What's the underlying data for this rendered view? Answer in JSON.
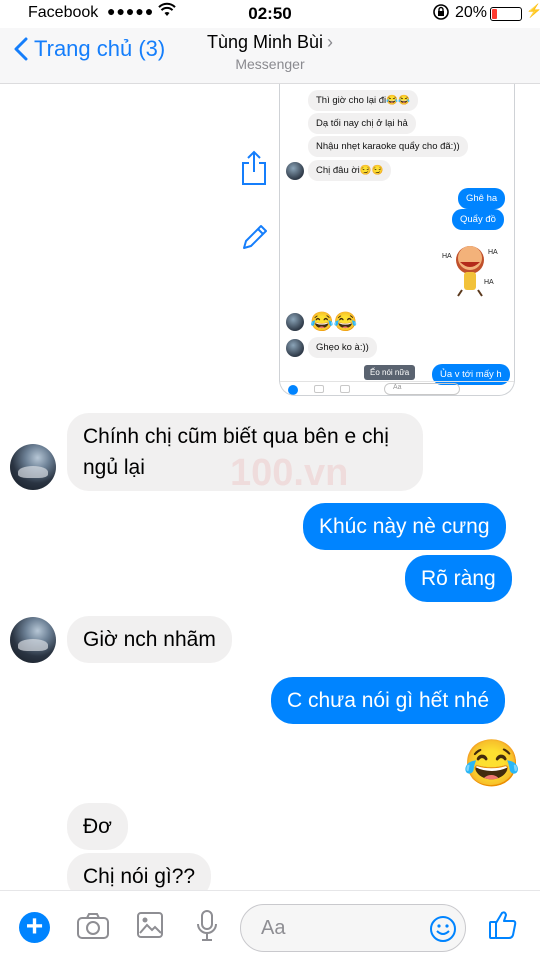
{
  "status_bar": {
    "carrier": "Facebook",
    "signal": "●●●●●",
    "time": "02:50",
    "battery_percent": "20%",
    "battery_level": 0.2
  },
  "nav": {
    "back_label": "Trang chủ (3)",
    "title": "Tùng Minh Bùi",
    "chevron": "›",
    "subtitle": "Messenger"
  },
  "embedded_screenshot": {
    "messages": [
      {
        "dir": "in",
        "text": "Thì giờ cho lại đi😂😂"
      },
      {
        "dir": "in",
        "text": "Dạ tối nay chị ở lại hả"
      },
      {
        "dir": "in",
        "text": "Nhậu nhẹt karaoke quẩy cho đã:))"
      },
      {
        "dir": "in",
        "text": "Chị đâu ời😏😏"
      },
      {
        "dir": "out",
        "text": "Ghê ha"
      },
      {
        "dir": "out",
        "text": "Quẩy đồ"
      },
      {
        "dir": "in",
        "text": "😂😂"
      },
      {
        "dir": "in",
        "text": "Ghẹo ko à:))"
      }
    ],
    "sticker_words": [
      "HA",
      "HA",
      "HA"
    ],
    "bottom_left_label": "Ếo nói nữa",
    "bottom_right_label": "Ủa v tới mấy h",
    "composer_placeholder": "Aa"
  },
  "messages": [
    {
      "dir": "in",
      "text_line1": "Chính chị cũm biết qua bên e chị",
      "text_line2": "ngủ lại"
    },
    {
      "dir": "out",
      "text": "Khúc này nè cưng"
    },
    {
      "dir": "out",
      "text": "Rõ ràng"
    },
    {
      "dir": "in",
      "text": "Giờ nch nhãm"
    },
    {
      "dir": "out",
      "text": "C chưa nói gì hết nhé"
    },
    {
      "dir": "out",
      "text": "😂"
    },
    {
      "dir": "in",
      "text": "Đơ"
    },
    {
      "dir": "in",
      "text": "Chị nói gì??"
    }
  ],
  "watermark": "100.vn",
  "composer": {
    "plus": "+",
    "placeholder": "Aa",
    "icons": [
      "plus-icon",
      "camera-icon",
      "image-icon",
      "microphone-icon",
      "smiley-icon",
      "thumbs-up-icon"
    ]
  },
  "colors": {
    "accent": "#0084ff",
    "ios_blue": "#157efb",
    "incoming_bubble": "#f1f0f0",
    "battery_red": "#ff3b30"
  }
}
